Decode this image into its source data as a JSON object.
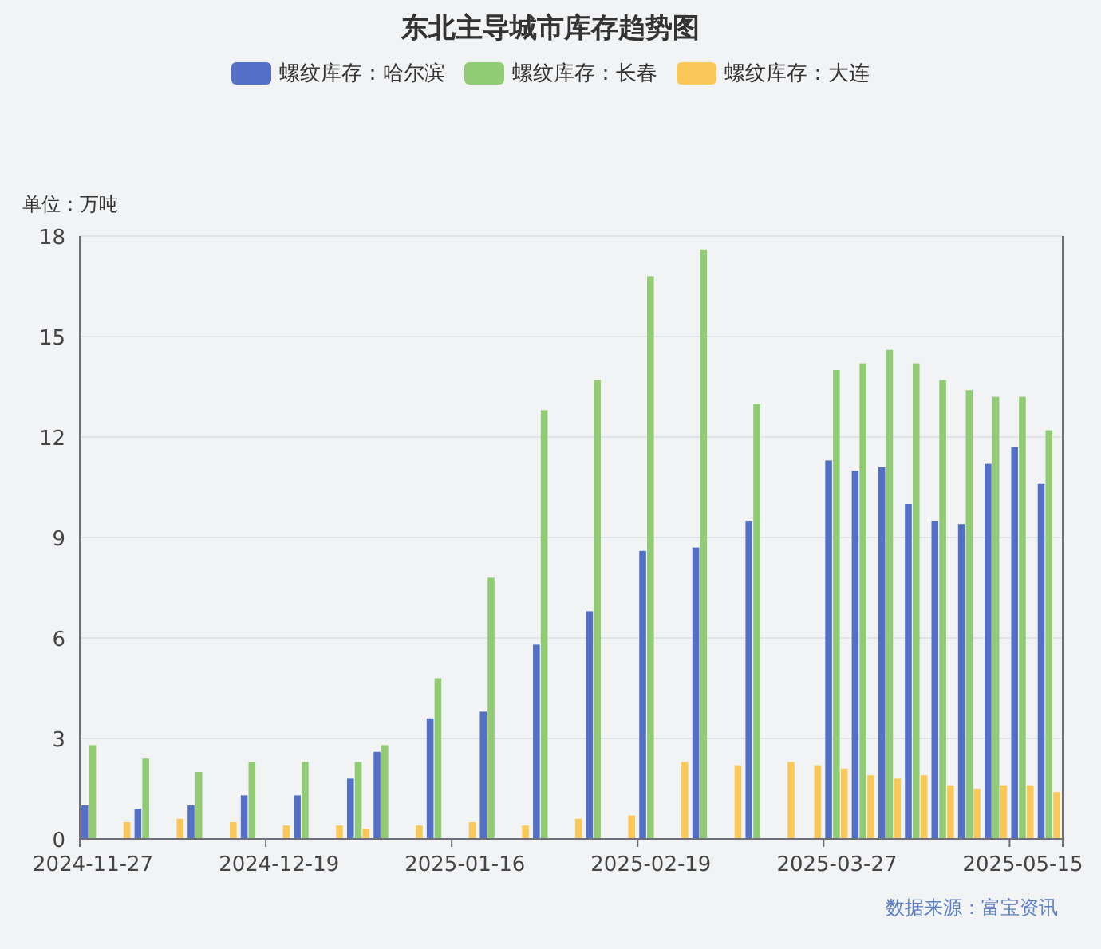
{
  "title": "东北主导城市库存趋势图",
  "unit_label": "单位：万吨",
  "source": "数据来源：富宝资讯",
  "chart_data": {
    "type": "bar",
    "categories": [
      "2024-11-27",
      null,
      null,
      null,
      null,
      null,
      null,
      "2024-12-19",
      null,
      null,
      null,
      null,
      null,
      null,
      "2025-01-16",
      null,
      null,
      null,
      null,
      null,
      null,
      "2025-02-19",
      null,
      null,
      null,
      null,
      null,
      null,
      "2025-03-27",
      null,
      null,
      null,
      null,
      null,
      null,
      "2025-05-15",
      null
    ],
    "ylim": [
      0,
      18
    ],
    "grid": true,
    "yticks": [
      0,
      3,
      6,
      9,
      12,
      15,
      18
    ],
    "series": [
      {
        "name": "螺纹库存：哈尔滨",
        "color": "#5470c6",
        "values": [
          1.0,
          null,
          0.9,
          null,
          1.0,
          null,
          1.3,
          null,
          1.3,
          null,
          1.8,
          2.6,
          null,
          3.6,
          null,
          3.8,
          null,
          5.8,
          null,
          6.8,
          null,
          8.6,
          null,
          8.7,
          null,
          9.5,
          null,
          null,
          11.3,
          11.0,
          11.1,
          10.0,
          9.5,
          9.4,
          11.2,
          11.7,
          10.6
        ]
      },
      {
        "name": "螺纹库存：长春",
        "color": "#91cc75",
        "values": [
          2.8,
          null,
          2.4,
          null,
          2.0,
          null,
          2.3,
          null,
          2.3,
          null,
          2.3,
          2.8,
          null,
          4.8,
          null,
          7.8,
          null,
          12.8,
          null,
          13.7,
          null,
          16.8,
          null,
          17.6,
          null,
          13.0,
          null,
          null,
          14.0,
          14.2,
          14.6,
          14.2,
          13.7,
          13.4,
          13.2,
          13.2,
          12.2
        ]
      },
      {
        "name": "螺纹库存：大连",
        "color": "#fac858",
        "values": [
          null,
          0.5,
          null,
          0.6,
          null,
          0.5,
          null,
          0.4,
          null,
          0.4,
          0.3,
          null,
          0.4,
          null,
          0.5,
          null,
          0.4,
          null,
          0.6,
          null,
          0.7,
          null,
          2.3,
          null,
          2.2,
          null,
          2.3,
          2.2,
          2.1,
          1.9,
          1.8,
          1.9,
          1.6,
          1.5,
          1.6,
          1.6,
          1.4
        ]
      }
    ]
  }
}
